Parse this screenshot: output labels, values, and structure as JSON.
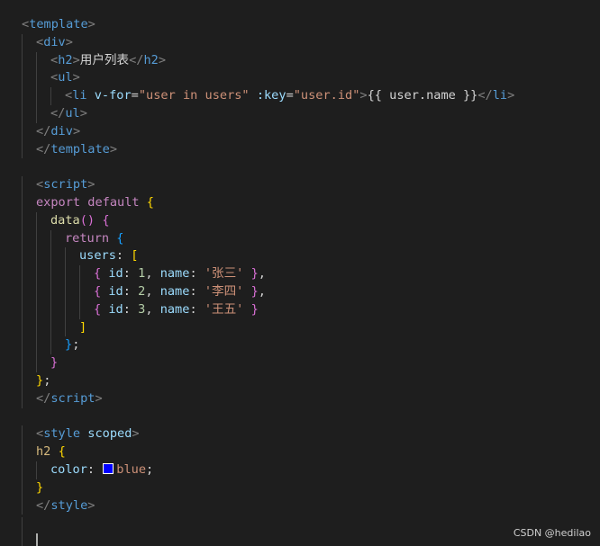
{
  "editor": {
    "background": "#1e1e1e",
    "swatch_color": "#0000ff",
    "lines": [
      {
        "indent": 0,
        "tokens": [
          [
            "tag-bracket",
            "<"
          ],
          [
            "tag-name",
            "template"
          ],
          [
            "tag-bracket",
            ">"
          ]
        ]
      },
      {
        "indent": 1,
        "tokens": [
          [
            "tag-bracket",
            "<"
          ],
          [
            "tag-name",
            "div"
          ],
          [
            "tag-bracket",
            ">"
          ]
        ]
      },
      {
        "indent": 2,
        "tokens": [
          [
            "tag-bracket",
            "<"
          ],
          [
            "tag-name",
            "h2"
          ],
          [
            "tag-bracket",
            ">"
          ],
          [
            "text",
            "用户列表"
          ],
          [
            "tag-bracket",
            "</"
          ],
          [
            "tag-name",
            "h2"
          ],
          [
            "tag-bracket",
            ">"
          ]
        ]
      },
      {
        "indent": 2,
        "tokens": [
          [
            "tag-bracket",
            "<"
          ],
          [
            "tag-name",
            "ul"
          ],
          [
            "tag-bracket",
            ">"
          ]
        ]
      },
      {
        "indent": 3,
        "tokens": [
          [
            "tag-bracket",
            "<"
          ],
          [
            "tag-name",
            "li"
          ],
          [
            "text",
            " "
          ],
          [
            "attr-name",
            "v-for"
          ],
          [
            "punct",
            "="
          ],
          [
            "attr-value",
            "\"user in users\""
          ],
          [
            "text",
            " "
          ],
          [
            "attr-name",
            ":key"
          ],
          [
            "punct",
            "="
          ],
          [
            "attr-value",
            "\"user.id\""
          ],
          [
            "tag-bracket",
            ">"
          ],
          [
            "text",
            "{{ user.name }}"
          ],
          [
            "tag-bracket",
            "</"
          ],
          [
            "tag-name",
            "li"
          ],
          [
            "tag-bracket",
            ">"
          ]
        ]
      },
      {
        "indent": 2,
        "tokens": [
          [
            "tag-bracket",
            "</"
          ],
          [
            "tag-name",
            "ul"
          ],
          [
            "tag-bracket",
            ">"
          ]
        ]
      },
      {
        "indent": 1,
        "tokens": [
          [
            "tag-bracket",
            "</"
          ],
          [
            "tag-name",
            "div"
          ],
          [
            "tag-bracket",
            ">"
          ]
        ]
      },
      {
        "indent": 0,
        "tokens": [
          [
            "tag-bracket",
            "</"
          ],
          [
            "tag-name",
            "template"
          ],
          [
            "tag-bracket",
            ">"
          ]
        ],
        "outdent": true
      },
      {
        "indent": 0,
        "tokens": []
      },
      {
        "indent": 0,
        "tokens": [
          [
            "tag-bracket",
            "<"
          ],
          [
            "tag-name",
            "script"
          ],
          [
            "tag-bracket",
            ">"
          ]
        ],
        "outdent": true
      },
      {
        "indent": 0,
        "tokens": [
          [
            "keyword",
            "export"
          ],
          [
            "text",
            " "
          ],
          [
            "keyword",
            "default"
          ],
          [
            "text",
            " "
          ],
          [
            "b1",
            "{"
          ]
        ],
        "outdent": true
      },
      {
        "indent": 1,
        "tokens": [
          [
            "func",
            "data"
          ],
          [
            "b2",
            "()"
          ],
          [
            "text",
            " "
          ],
          [
            "b2",
            "{"
          ]
        ],
        "outdent": true
      },
      {
        "indent": 2,
        "tokens": [
          [
            "keyword",
            "return"
          ],
          [
            "text",
            " "
          ],
          [
            "b3",
            "{"
          ]
        ],
        "outdent": true
      },
      {
        "indent": 3,
        "tokens": [
          [
            "prop",
            "users"
          ],
          [
            "punct",
            ": "
          ],
          [
            "b1",
            "["
          ]
        ],
        "outdent": true
      },
      {
        "indent": 4,
        "tokens": [
          [
            "b2",
            "{"
          ],
          [
            "text",
            " "
          ],
          [
            "prop",
            "id"
          ],
          [
            "punct",
            ": "
          ],
          [
            "num",
            "1"
          ],
          [
            "punct",
            ", "
          ],
          [
            "prop",
            "name"
          ],
          [
            "punct",
            ": "
          ],
          [
            "str",
            "'张三'"
          ],
          [
            "text",
            " "
          ],
          [
            "b2",
            "}"
          ],
          [
            "punct",
            ","
          ]
        ],
        "outdent": true
      },
      {
        "indent": 4,
        "tokens": [
          [
            "b2",
            "{"
          ],
          [
            "text",
            " "
          ],
          [
            "prop",
            "id"
          ],
          [
            "punct",
            ": "
          ],
          [
            "num",
            "2"
          ],
          [
            "punct",
            ", "
          ],
          [
            "prop",
            "name"
          ],
          [
            "punct",
            ": "
          ],
          [
            "str",
            "'李四'"
          ],
          [
            "text",
            " "
          ],
          [
            "b2",
            "}"
          ],
          [
            "punct",
            ","
          ]
        ],
        "outdent": true
      },
      {
        "indent": 4,
        "tokens": [
          [
            "b2",
            "{"
          ],
          [
            "text",
            " "
          ],
          [
            "prop",
            "id"
          ],
          [
            "punct",
            ": "
          ],
          [
            "num",
            "3"
          ],
          [
            "punct",
            ", "
          ],
          [
            "prop",
            "name"
          ],
          [
            "punct",
            ": "
          ],
          [
            "str",
            "'王五'"
          ],
          [
            "text",
            " "
          ],
          [
            "b2",
            "}"
          ]
        ],
        "outdent": true
      },
      {
        "indent": 3,
        "tokens": [
          [
            "b1",
            "]"
          ]
        ],
        "outdent": true
      },
      {
        "indent": 2,
        "tokens": [
          [
            "b3",
            "}"
          ],
          [
            "punct",
            ";"
          ]
        ],
        "outdent": true
      },
      {
        "indent": 1,
        "tokens": [
          [
            "b2",
            "}"
          ]
        ],
        "outdent": true
      },
      {
        "indent": 0,
        "tokens": [
          [
            "b1",
            "}"
          ],
          [
            "punct",
            ";"
          ]
        ],
        "outdent": true
      },
      {
        "indent": 0,
        "tokens": [
          [
            "tag-bracket",
            "</"
          ],
          [
            "tag-name",
            "script"
          ],
          [
            "tag-bracket",
            ">"
          ]
        ],
        "outdent": true
      },
      {
        "indent": 0,
        "tokens": []
      },
      {
        "indent": 0,
        "tokens": [
          [
            "tag-bracket",
            "<"
          ],
          [
            "tag-name",
            "style"
          ],
          [
            "text",
            " "
          ],
          [
            "attr-name",
            "scoped"
          ],
          [
            "tag-bracket",
            ">"
          ]
        ],
        "outdent": true
      },
      {
        "indent": 0,
        "tokens": [
          [
            "selector",
            "h2"
          ],
          [
            "text",
            " "
          ],
          [
            "b1",
            "{"
          ]
        ],
        "outdent": true
      },
      {
        "indent": 1,
        "tokens": [
          [
            "css-prop",
            "color"
          ],
          [
            "punct",
            ": "
          ],
          [
            "swatch",
            ""
          ],
          [
            "css-val",
            "blue"
          ],
          [
            "punct",
            ";"
          ]
        ],
        "outdent": true
      },
      {
        "indent": 0,
        "tokens": [
          [
            "b1",
            "}"
          ]
        ],
        "outdent": true
      },
      {
        "indent": 0,
        "tokens": [
          [
            "tag-bracket",
            "</"
          ],
          [
            "tag-name",
            "style"
          ],
          [
            "tag-bracket",
            ">"
          ]
        ],
        "outdent": true
      }
    ]
  },
  "watermark": "CSDN @hedilao"
}
